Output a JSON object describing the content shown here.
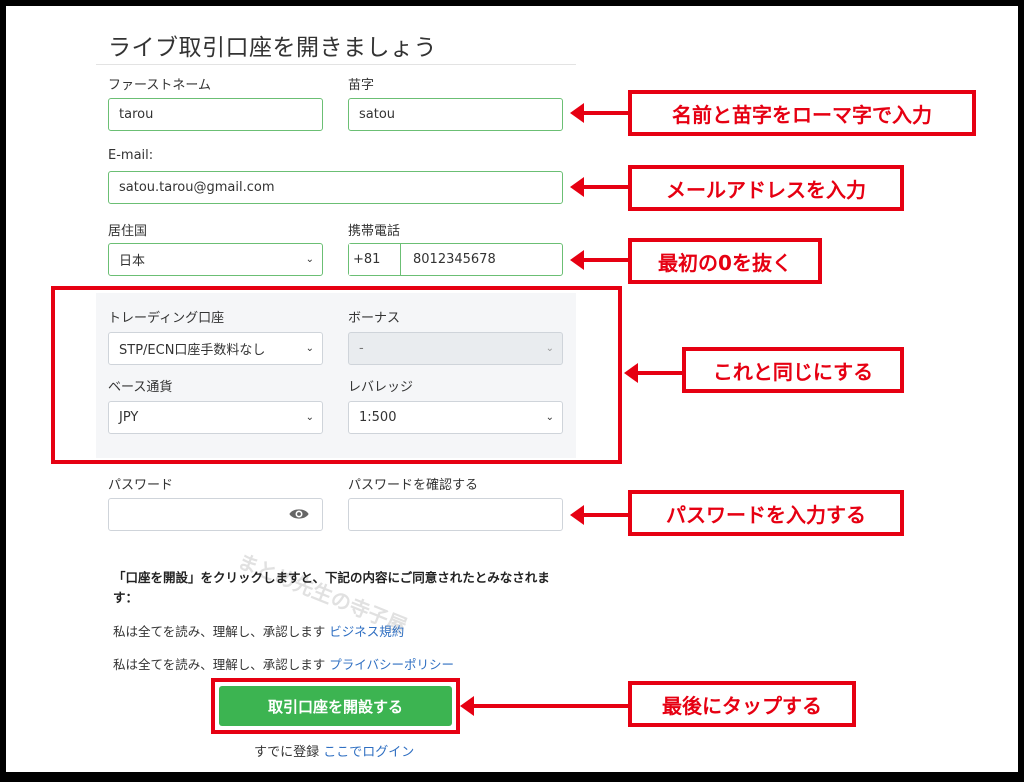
{
  "form": {
    "title": "ライブ取引口座を開きましょう",
    "first_name_label": "ファーストネーム",
    "first_name_value": "tarou",
    "last_name_label": "苗字",
    "last_name_value": "satou",
    "email_label": "E-mail:",
    "email_value": "satou.tarou@gmail.com",
    "country_label": "居住国",
    "country_value": "日本",
    "phone_label": "携帯電話",
    "phone_prefix": "+81",
    "phone_value": "8012345678",
    "account_label": "トレーディング口座",
    "account_value": "STP/ECN口座手数料なし",
    "bonus_label": "ボーナス",
    "bonus_value": "-",
    "currency_label": "ベース通貨",
    "currency_value": "JPY",
    "leverage_label": "レバレッジ",
    "leverage_value": "1:500",
    "password_label": "パスワード",
    "password_confirm_label": "パスワードを確認する",
    "consent_text": "「口座を開設」をクリックしますと、下記の内容にご同意されたとみなされます：",
    "agree1_text": "私は全てを読み、理解し、承認します ",
    "agree1_link": "ビジネス規約",
    "agree2_text": "私は全てを読み、理解し、承認します ",
    "agree2_link": "プライバシーポリシー",
    "submit_label": "取引口座を開設する",
    "login_text": "すでに登録 ",
    "login_link": "ここでログイン"
  },
  "annotations": {
    "name": "名前と苗字をローマ字で入力",
    "email": "メールアドレスを入力",
    "phone": "最初の0を抜く",
    "panel": "これと同じにする",
    "password": "パスワードを入力する",
    "submit": "最後にタップする"
  },
  "watermark": "まとめ先生の寺子屋",
  "colors": {
    "accent_red": "#e60012",
    "button_green": "#3cb451",
    "input_border_green": "#6bbf74",
    "link_blue": "#2f6fc2"
  }
}
